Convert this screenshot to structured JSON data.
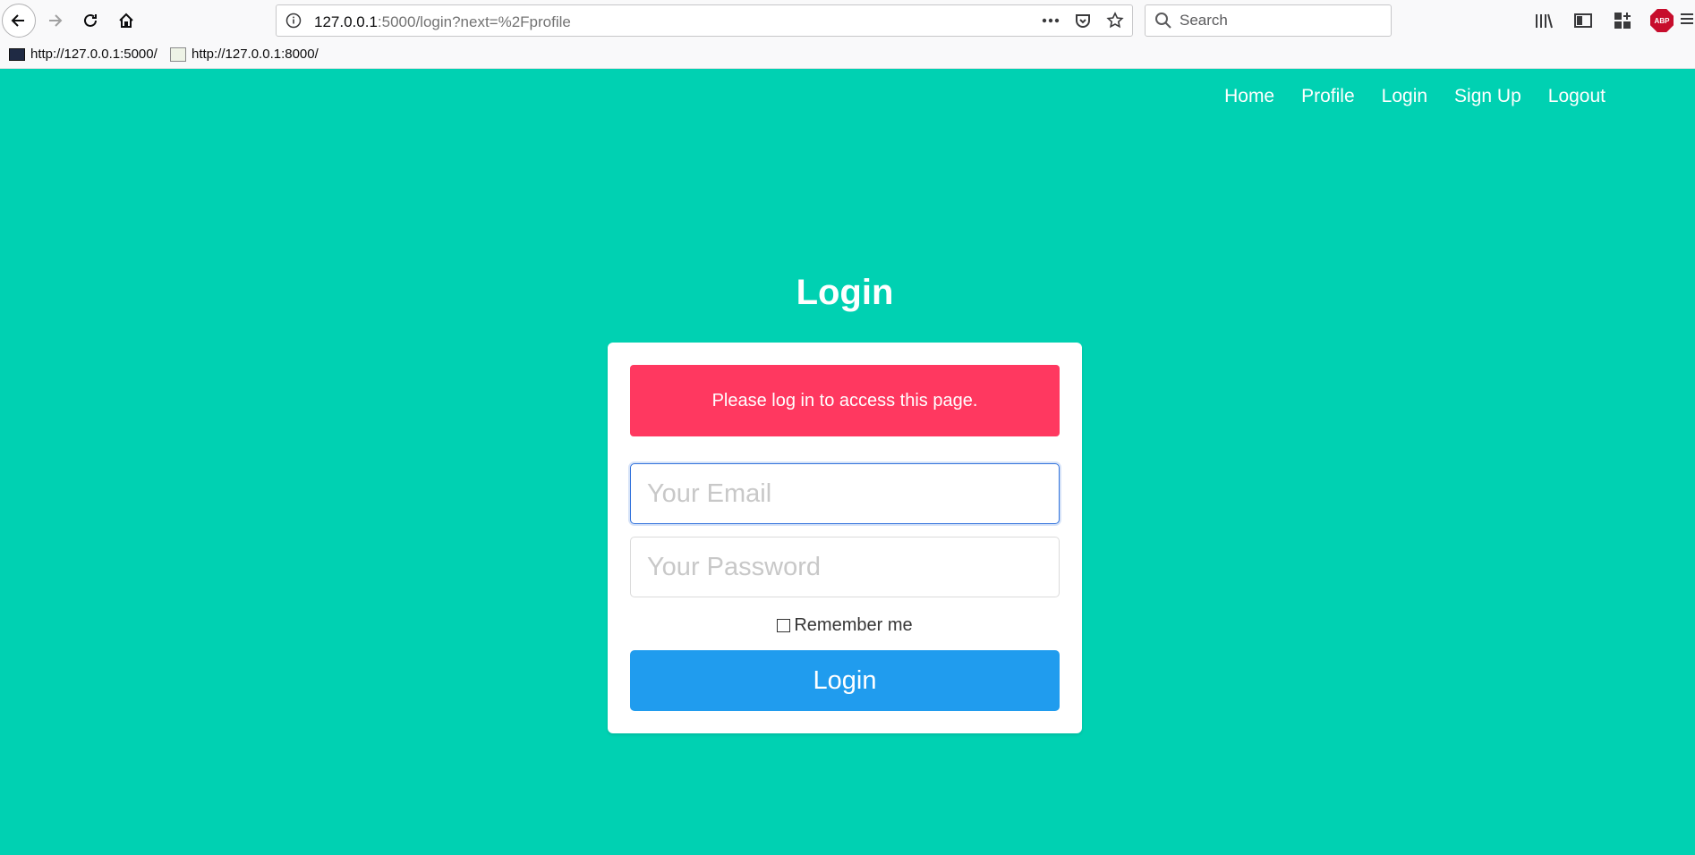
{
  "browser": {
    "url_host": "127.0.0.1",
    "url_rest": ":5000/login?next=%2Fprofile",
    "search_placeholder": "Search",
    "bookmarks": [
      {
        "label": "http://127.0.0.1:5000/"
      },
      {
        "label": "http://127.0.0.1:8000/"
      }
    ],
    "abp_label": "ABP"
  },
  "nav": {
    "items": [
      {
        "label": "Home"
      },
      {
        "label": "Profile"
      },
      {
        "label": "Login"
      },
      {
        "label": "Sign Up"
      },
      {
        "label": "Logout"
      }
    ]
  },
  "page": {
    "title": "Login",
    "notification": "Please log in to access this page.",
    "email_placeholder": "Your Email",
    "password_placeholder": "Your Password",
    "remember_label": "Remember me",
    "submit_label": "Login"
  },
  "colors": {
    "background": "#00d1b2",
    "notification": "#ff3860",
    "button": "#209cee"
  }
}
